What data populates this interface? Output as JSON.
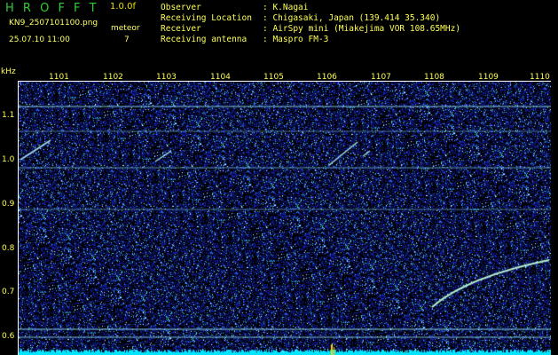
{
  "app": {
    "title": "H R O F F T",
    "version": "1.0.0f",
    "filename": "KN9_2507101100.png",
    "mode": "meteor",
    "datetime": "25.07.10 11:00",
    "count": "7"
  },
  "station": {
    "labels": [
      "Observer",
      "Receiving Location",
      "Receiver",
      "Receiving antenna"
    ],
    "values": [
      ": K.Nagai",
      ": Chigasaki, Japan (139.414 35.340)",
      ": AirSpy mini (Miakejima VOR 108.65MHz)",
      ": Maspro FM-3"
    ]
  },
  "axes": {
    "unit": "kHz",
    "x_ticks": [
      "1101",
      "1102",
      "1103",
      "1104",
      "1105",
      "1106",
      "1107",
      "1108",
      "1109",
      "1110"
    ],
    "y_ticks": [
      "1.1",
      "1.0",
      "0.9",
      "0.8",
      "0.7",
      "0.6"
    ]
  },
  "colors": {
    "background": "#000000",
    "noise": "#1a2aa8",
    "echo": "#9ff0ff",
    "labels": "#ffff55",
    "title": "#33cc33",
    "baseline": "#00ffff"
  }
}
